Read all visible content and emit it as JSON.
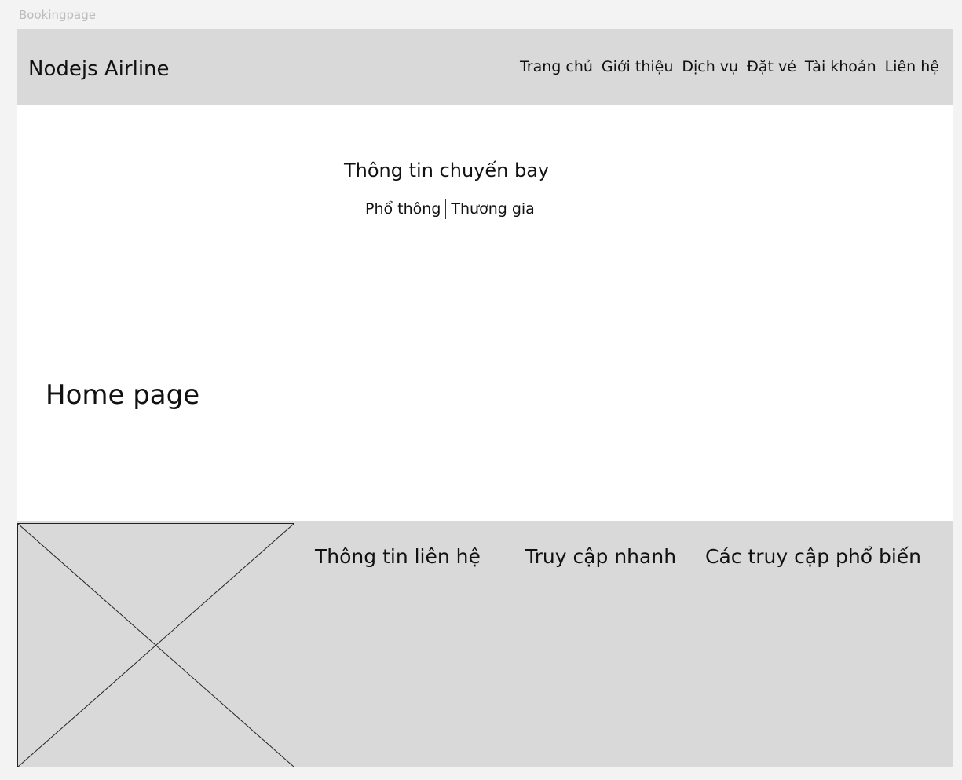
{
  "frame": {
    "label": "Bookingpage"
  },
  "header": {
    "brand": "Nodejs Airline",
    "nav": [
      "Trang chủ",
      "Giới thiệu",
      "Dịch vụ",
      "Đặt vé",
      "Tài khoản",
      "Liên hệ"
    ]
  },
  "main": {
    "flight_title": "Thông tin chuyến bay",
    "class_tabs": [
      "Phổ thông",
      "Thương gia"
    ],
    "page_label": "Home page"
  },
  "footer": {
    "image_icon": "image-placeholder-icon",
    "headings": [
      "Thông tin liên hệ",
      "Truy cập nhanh",
      "Các truy cập phổ biến"
    ]
  },
  "colors": {
    "canvas": "#f3f3f3",
    "panel": "#d9d9d9",
    "page": "#ffffff",
    "text": "#111111"
  }
}
